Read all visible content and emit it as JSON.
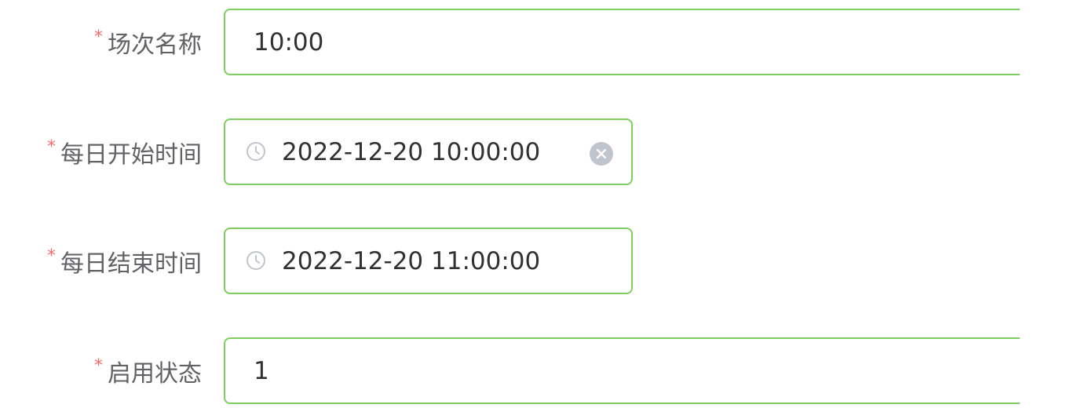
{
  "form": {
    "fields": [
      {
        "label": "场次名称",
        "required": true,
        "value": "10:00"
      },
      {
        "label": "每日开始时间",
        "required": true,
        "value": "2022-12-20 10:00:00"
      },
      {
        "label": "每日结束时间",
        "required": true,
        "value": "2022-12-20 11:00:00"
      },
      {
        "label": "启用状态",
        "required": true,
        "value": "1"
      }
    ],
    "required_mark": "*"
  },
  "colors": {
    "border": "#7ccf60",
    "required": "#f56c6c",
    "label_text": "#606266",
    "value_text": "#303133",
    "icon": "#c0c4cc"
  },
  "icons": {
    "time_prefix": "clock-icon",
    "clear": "circle-close-icon"
  }
}
